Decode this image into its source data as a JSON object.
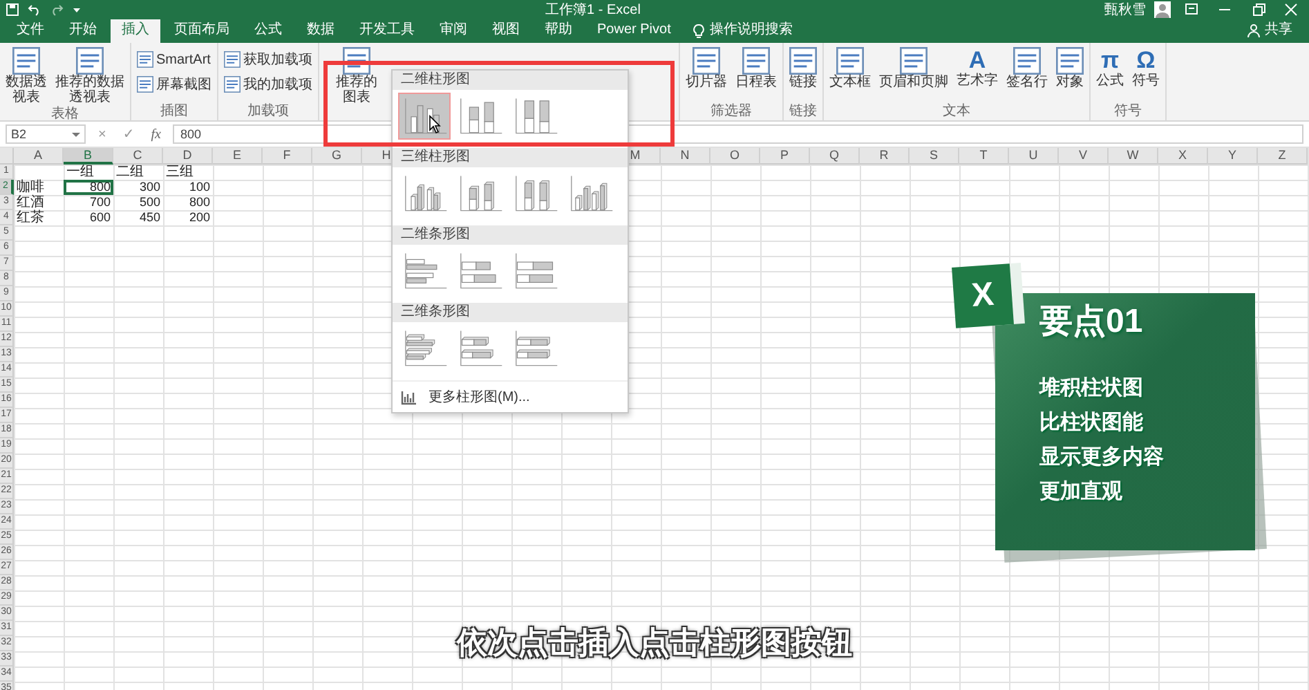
{
  "title_bar": {
    "title": "工作簿1 - Excel",
    "user": "甄秋雪"
  },
  "ribbon_tabs": [
    {
      "label": "文件",
      "selected": false
    },
    {
      "label": "开始",
      "selected": false
    },
    {
      "label": "插入",
      "selected": true
    },
    {
      "label": "页面布局",
      "selected": false
    },
    {
      "label": "公式",
      "selected": false
    },
    {
      "label": "数据",
      "selected": false
    },
    {
      "label": "开发工具",
      "selected": false
    },
    {
      "label": "审阅",
      "selected": false
    },
    {
      "label": "视图",
      "selected": false
    },
    {
      "label": "帮助",
      "selected": false
    },
    {
      "label": "Power Pivot",
      "selected": false
    }
  ],
  "tell_me": "操作说明搜索",
  "share": "共享",
  "ribbon_groups": [
    {
      "label": "表格",
      "kind": "plain",
      "buttons": [
        {
          "kind": "tall",
          "label": "数据透视表"
        },
        {
          "kind": "large",
          "label": "推荐的数据透视表"
        }
      ]
    },
    {
      "label": "插图",
      "kind": "plain",
      "buttons": [
        {
          "kind": "small",
          "label": "SmartArt"
        },
        {
          "kind": "small",
          "label": "屏幕截图"
        }
      ]
    },
    {
      "label": "加载项",
      "kind": "plain",
      "buttons": [
        {
          "kind": "small",
          "label": "获取加载项"
        },
        {
          "kind": "small",
          "label": "我的加载项"
        }
      ]
    },
    {
      "kind": "wide",
      "buttons": [
        {
          "kind": "tall",
          "label": "推荐的图表"
        }
      ]
    },
    {
      "label": "筛选器",
      "kind": "plain",
      "buttons": [
        {
          "kind": "large",
          "label": "切片器"
        },
        {
          "kind": "large",
          "label": "日程表"
        }
      ]
    },
    {
      "label": "链接",
      "kind": "plain",
      "buttons": [
        {
          "kind": "large",
          "label": "链接"
        }
      ]
    },
    {
      "label": "文本",
      "kind": "plain",
      "buttons": [
        {
          "kind": "large",
          "label": "文本框"
        },
        {
          "kind": "large",
          "label": "页眉和页脚"
        },
        {
          "kind": "large",
          "label": "艺术字",
          "glyph": "A"
        },
        {
          "kind": "large",
          "label": "签名行"
        },
        {
          "kind": "large",
          "label": "对象"
        }
      ]
    },
    {
      "label": "符号",
      "kind": "plain",
      "buttons": [
        {
          "kind": "large",
          "label": "公式",
          "glyph": "π"
        },
        {
          "kind": "large",
          "label": "符号",
          "glyph": "Ω"
        }
      ]
    }
  ],
  "formula_bar": {
    "name_box": "B2",
    "buttons": [
      "×",
      "✓",
      "fx"
    ],
    "value": "800"
  },
  "sheet": {
    "columns": [
      {
        "kind": "header",
        "label": "A",
        "selected": false
      },
      {
        "kind": "header",
        "label": "B",
        "selected": true
      },
      {
        "kind": "header",
        "label": "C",
        "selected": false
      },
      {
        "kind": "header",
        "label": "D",
        "selected": false
      },
      {
        "kind": "header",
        "label": "E",
        "selected": false
      },
      {
        "kind": "header",
        "label": "F",
        "selected": false
      },
      {
        "kind": "header",
        "label": "G",
        "selected": false
      },
      {
        "kind": "header",
        "label": "H",
        "selected": false
      },
      {
        "kind": "covered"
      },
      {
        "kind": "covered"
      },
      {
        "kind": "covered"
      },
      {
        "kind": "covered"
      },
      {
        "kind": "header",
        "label": "M",
        "selected": false
      },
      {
        "kind": "header",
        "label": "N",
        "selected": false
      },
      {
        "kind": "header",
        "label": "O",
        "selected": false
      },
      {
        "kind": "header",
        "label": "P",
        "selected": false
      },
      {
        "kind": "header",
        "label": "Q",
        "selected": false
      },
      {
        "kind": "header",
        "label": "R",
        "selected": false
      },
      {
        "kind": "header",
        "label": "S",
        "selected": false
      },
      {
        "kind": "header",
        "label": "T",
        "selected": false
      },
      {
        "kind": "header",
        "label": "U",
        "selected": false
      },
      {
        "kind": "header",
        "label": "V",
        "selected": false
      },
      {
        "kind": "header",
        "label": "W",
        "selected": false
      },
      {
        "kind": "header",
        "label": "X",
        "selected": false
      },
      {
        "kind": "header",
        "label": "Y",
        "selected": false
      },
      {
        "kind": "header",
        "label": "Z",
        "selected": false
      }
    ],
    "rows": [
      {
        "number": "1",
        "selected": false
      },
      {
        "number": "2",
        "selected": true
      },
      {
        "number": "3",
        "selected": false
      },
      {
        "number": "4",
        "selected": false
      },
      {
        "number": "5",
        "selected": false
      },
      {
        "number": "6",
        "selected": false
      },
      {
        "number": "7",
        "selected": false
      },
      {
        "number": "8",
        "selected": false
      },
      {
        "number": "9",
        "selected": false
      },
      {
        "number": "10",
        "selected": false
      },
      {
        "number": "11",
        "selected": false
      },
      {
        "number": "12",
        "selected": false
      },
      {
        "number": "13",
        "selected": false
      },
      {
        "number": "14",
        "selected": false
      },
      {
        "number": "15",
        "selected": false
      },
      {
        "number": "16",
        "selected": false
      },
      {
        "number": "17",
        "selected": false
      },
      {
        "number": "18",
        "selected": false
      },
      {
        "number": "19",
        "selected": false
      },
      {
        "number": "20",
        "selected": false
      },
      {
        "number": "21",
        "selected": false
      },
      {
        "number": "22",
        "selected": false
      },
      {
        "number": "23",
        "selected": false
      },
      {
        "number": "24",
        "selected": false
      },
      {
        "number": "25",
        "selected": false
      },
      {
        "number": "26",
        "selected": false
      },
      {
        "number": "27",
        "selected": false
      },
      {
        "number": "28",
        "selected": false
      },
      {
        "number": "29",
        "selected": false
      },
      {
        "number": "30",
        "selected": false
      },
      {
        "number": "31",
        "selected": false
      },
      {
        "number": "32",
        "selected": false
      },
      {
        "number": "33",
        "selected": false
      },
      {
        "number": "34",
        "selected": false
      },
      {
        "number": "35",
        "selected": false
      }
    ],
    "header_cells": [
      "一组",
      "二组",
      "三组"
    ],
    "data_rows": [
      {
        "label": "咖啡",
        "values": [
          {
            "text": "800",
            "selected": true
          },
          {
            "text": "300",
            "selected": false
          },
          {
            "text": "100",
            "selected": false
          }
        ]
      },
      {
        "label": "红酒",
        "values": [
          {
            "text": "700",
            "selected": false
          },
          {
            "text": "500",
            "selected": false
          },
          {
            "text": "800",
            "selected": false
          }
        ]
      },
      {
        "label": "红茶",
        "values": [
          {
            "text": "600",
            "selected": false
          },
          {
            "text": "450",
            "selected": false
          },
          {
            "text": "200",
            "selected": false
          }
        ]
      }
    ]
  },
  "chart_gallery": {
    "sections": [
      {
        "title": "二维柱形图",
        "items": [
          {
            "kind": "column-clustered",
            "selected": true
          },
          {
            "kind": "column-stacked",
            "selected": false
          },
          {
            "kind": "column-percent",
            "selected": false
          }
        ]
      },
      {
        "title": "三维柱形图",
        "items": [
          {
            "kind": "column3d-clustered",
            "selected": false
          },
          {
            "kind": "column3d-stacked",
            "selected": false
          },
          {
            "kind": "column3d-percent",
            "selected": false
          },
          {
            "kind": "column3d-deep",
            "selected": false
          }
        ]
      },
      {
        "title": "二维条形图",
        "items": [
          {
            "kind": "bar-clustered",
            "selected": false
          },
          {
            "kind": "bar-stacked",
            "selected": false
          },
          {
            "kind": "bar-percent",
            "selected": false
          }
        ]
      },
      {
        "title": "三维条形图",
        "items": [
          {
            "kind": "bar3d-clustered",
            "selected": false
          },
          {
            "kind": "bar3d-stacked",
            "selected": false
          },
          {
            "kind": "bar3d-percent",
            "selected": false
          }
        ]
      }
    ],
    "more": "更多柱形图(M)..."
  },
  "tip_card": {
    "logo_letter": "X",
    "heading": "要点01",
    "lines": [
      "堆积柱状图",
      "比柱状图能",
      "显示更多内容",
      "更加直观"
    ]
  },
  "caption": "依次点击插入点击柱形图按钮"
}
